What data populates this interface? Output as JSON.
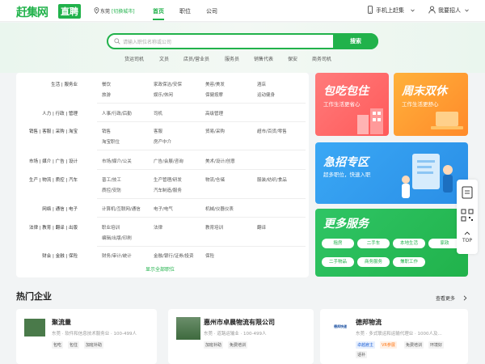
{
  "header": {
    "logo_text": "赶集网",
    "logo_tag": "直聘",
    "city": "东莞",
    "switch_city": "[切换城市]",
    "nav": [
      "首页",
      "职位",
      "公司"
    ],
    "mobile": "手机上赶集",
    "recruit": "我要招人"
  },
  "search": {
    "placeholder": "请输入职位名称或公司",
    "button": "搜索",
    "hot": [
      "货运司机",
      "文员",
      "店员/营业员",
      "服务员",
      "销售代表",
      "保安",
      "商务司机"
    ]
  },
  "categories": [
    {
      "name": "生活 | 服务业",
      "items": [
        "餐饮",
        "家政保洁/安保",
        "美容/美发",
        "酒店",
        "旅游",
        "娱乐/休闲",
        "保健按摩",
        "运动健身"
      ]
    },
    {
      "name": "人力 | 行政 | 管理",
      "items": [
        "人事/行政/后勤",
        "司机",
        "高级管理"
      ]
    },
    {
      "name": "销售 | 客服 | 采购 | 淘宝",
      "items": [
        "销售",
        "客服",
        "贸易/采购",
        "超市/百货/零售",
        "淘宝职位",
        "房产中介"
      ]
    },
    {
      "name": "市场 | 媒介 | 广告 | 设计",
      "items": [
        "市场/媒介/公关",
        "广告/会展/咨询",
        "美术/设计/创意"
      ]
    },
    {
      "name": "生产 | 物流 | 质控 | 汽车",
      "items": [
        "普工/技工",
        "生产管理/研发",
        "物流/仓储",
        "服装/纺织/食品",
        "质控/安防",
        "汽车制造/服务"
      ]
    },
    {
      "name": "网络 | 通信 | 电子",
      "items": [
        "计算机/互联网/通信",
        "电子/电气",
        "机械/仪器仪表"
      ]
    },
    {
      "name": "法律 | 教育 | 翻译 | 出版",
      "items": [
        "职业培训",
        "法律",
        "教育培训",
        "翻译",
        "编辑/出版/印刷"
      ]
    },
    {
      "name": "财会 | 金融 | 保险",
      "items": [
        "财务/审计/统计",
        "金融/银行/证券/投资",
        "保险"
      ]
    }
  ],
  "more_jobs": "显示全部职位",
  "cards": {
    "c1_title": "包吃包住",
    "c1_sub": "工作生活更省心",
    "c2_title": "周末双休",
    "c2_sub": "工作生活更舒心",
    "c3_title": "急招专区",
    "c3_sub": "超多职位，快速入职",
    "c4_title": "更多服务",
    "services": [
      "租房",
      "二手车",
      "本地生活",
      "家政",
      "二手物品",
      "商务服务",
      "兼职工作"
    ]
  },
  "side": {
    "top": "TOP"
  },
  "companies_section": {
    "title": "热门企业",
    "more": "查看更多"
  },
  "companies": [
    {
      "name": "聚流量",
      "meta": "东莞 · 软件和信息技术服务业 · 100-499人",
      "tags": [
        "包吃",
        "包住",
        "加班补助"
      ]
    },
    {
      "name": "惠州市卓晨物流有限公司",
      "meta": "东莞 · 道路运输业 · 100-499人",
      "tags": [
        "加班补助",
        "免费培训"
      ]
    },
    {
      "name": "德邦物流",
      "meta": "东莞 · 多式联运和运输代理业 · 1000人及...",
      "tags": [
        "卓越雇主",
        "VR参展",
        "免费培训",
        "环境好",
        "话补"
      ],
      "logo_text": "德邦快递"
    }
  ],
  "colors": {
    "brand": "#21b24b",
    "orange": "#ff8a2a",
    "red": "#ff6b6b",
    "blue": "#2e9bf0"
  }
}
